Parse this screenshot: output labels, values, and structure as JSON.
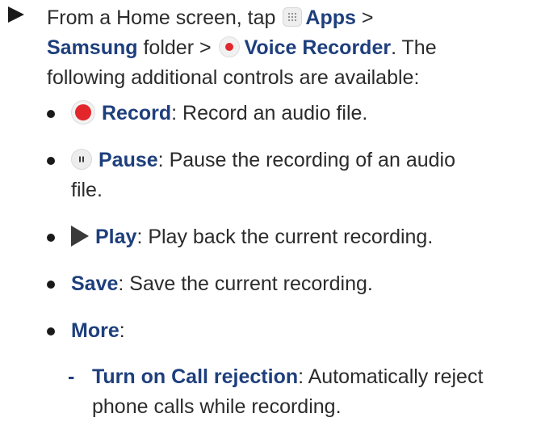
{
  "step": {
    "line1_prefix": "From a Home screen, tap",
    "apps": "Apps",
    "gt1": ">",
    "samsung": "Samsung",
    "folder_gt": "folder >",
    "voice_recorder": "Voice Recorder",
    "line2_suffix": ". The",
    "line3": "following additional controls are available:"
  },
  "bullets": {
    "record": {
      "label": "Record",
      "desc": ": Record an audio file."
    },
    "pause": {
      "label": "Pause",
      "desc_line1": ": Pause the recording of an audio",
      "desc_line2": "file."
    },
    "play": {
      "label": "Play",
      "desc": ": Play back the current recording."
    },
    "save": {
      "label": "Save",
      "desc": ": Save the current recording."
    },
    "more": {
      "label": "More",
      "desc": ":"
    }
  },
  "sub_bullet": {
    "dash": "-",
    "label": "Turn on Call rejection",
    "desc_line1": ": Automatically reject",
    "desc_line2": "phone calls while recording."
  },
  "colors": {
    "emphasis": "#1e3f7d",
    "record_red": "#e2262c",
    "text": "#2b2b2b"
  },
  "icons": [
    "step-arrow-icon",
    "apps-icon",
    "voice-recorder-icon",
    "record-icon",
    "pause-icon",
    "play-icon"
  ]
}
